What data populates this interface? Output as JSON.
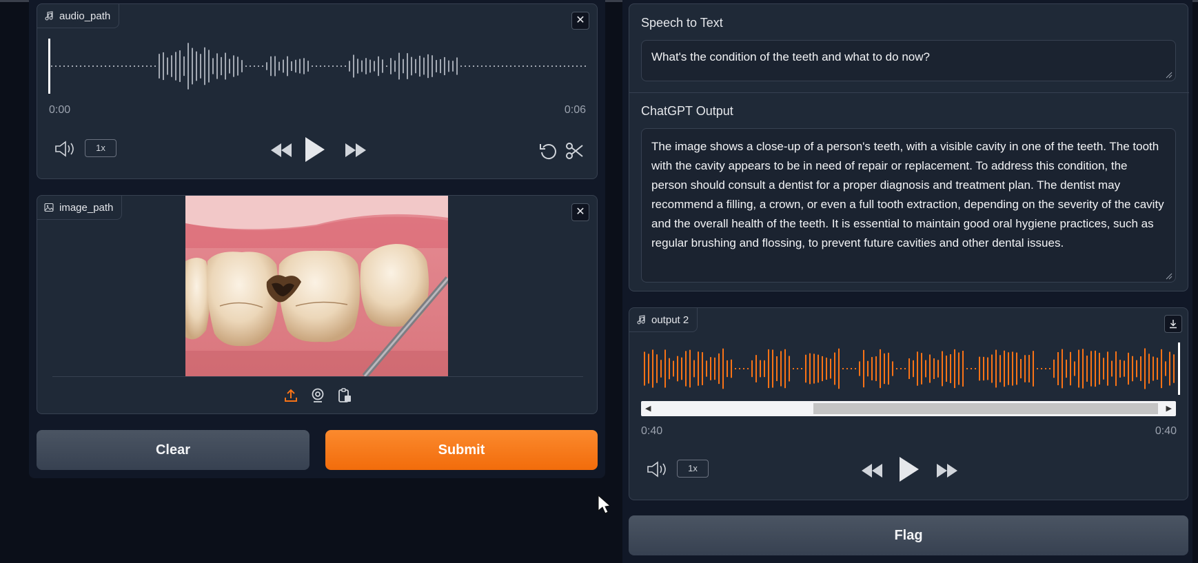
{
  "audio_input": {
    "label": "audio_path",
    "time_start": "0:00",
    "time_end": "0:06",
    "rate": "1x",
    "icons": [
      "music-note-icon",
      "close-icon",
      "volume-icon",
      "rewind-icon",
      "play-icon",
      "fast-forward-icon",
      "undo-icon",
      "scissors-icon"
    ]
  },
  "image_input": {
    "label": "image_path",
    "icons": [
      "image-icon",
      "close-icon",
      "upload-icon",
      "webcam-icon",
      "clipboard-icon"
    ]
  },
  "buttons": {
    "clear": "Clear",
    "submit": "Submit",
    "flag": "Flag"
  },
  "speech_to_text": {
    "label": "Speech to Text",
    "value": "What's the condition of the teeth and what to do now?"
  },
  "chatgpt_output": {
    "label": "ChatGPT Output",
    "value": "The image shows a close-up of a person's teeth, with a visible cavity in one of the teeth. The tooth with the cavity appears to be in need of repair or replacement. To address this condition, the person should consult a dentist for a proper diagnosis and treatment plan. The dentist may recommend a filling, a crown, or even a full tooth extraction, depending on the severity of the cavity and the overall health of the teeth. It is essential to maintain good oral hygiene practices, such as regular brushing and flossing, to prevent future cavities and other dental issues."
  },
  "output_audio": {
    "label": "output 2",
    "time_start": "0:40",
    "time_end": "0:40",
    "rate": "1x",
    "icons": [
      "music-note-icon",
      "download-icon",
      "volume-icon",
      "rewind-icon",
      "play-icon",
      "fast-forward-icon"
    ]
  },
  "colors": {
    "background": "#0b0f19",
    "panel": "#1f2937",
    "accent": "#f97316",
    "waveform_input": "#9ca3af",
    "waveform_output": "#f97316"
  }
}
